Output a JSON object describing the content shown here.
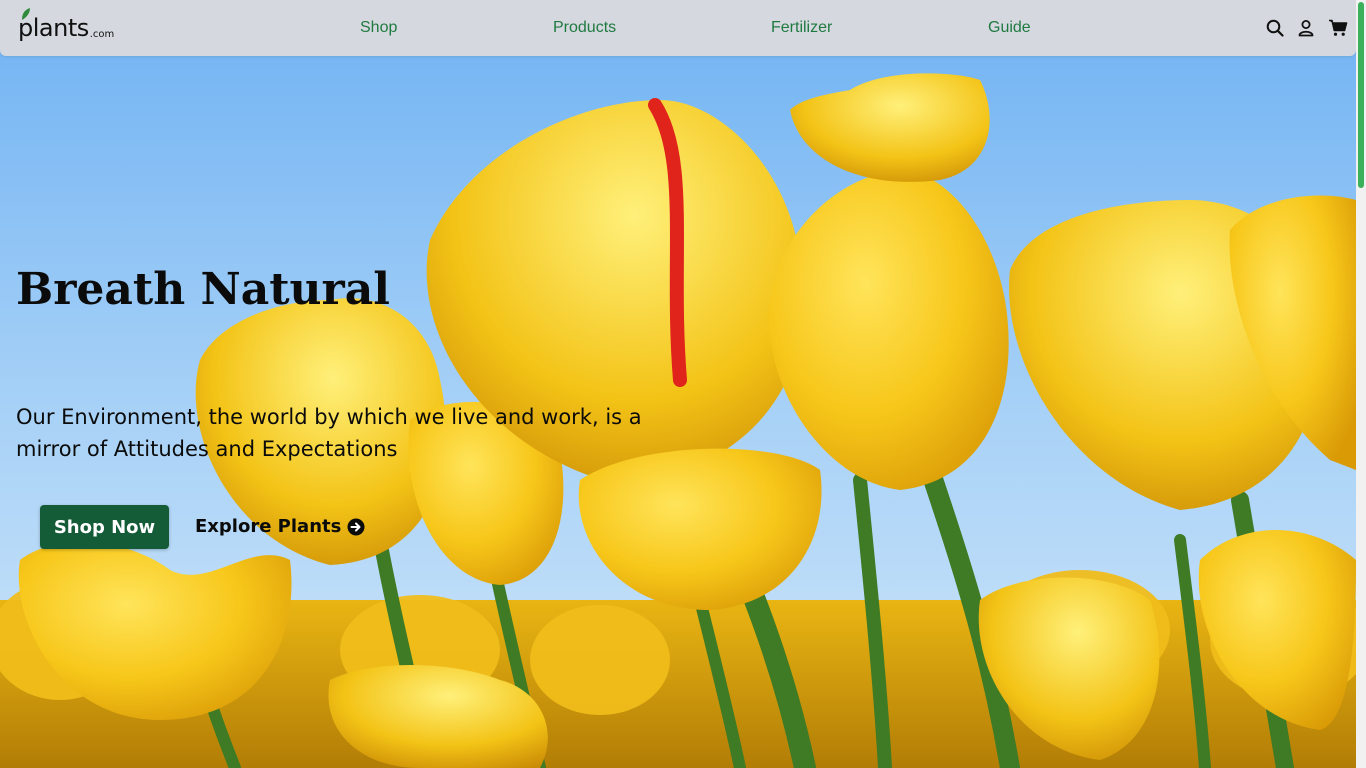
{
  "brand": {
    "name": "plants",
    "suffix": ".com"
  },
  "nav": {
    "links": [
      {
        "label": "Shop"
      },
      {
        "label": "Products"
      },
      {
        "label": "Fertilizer"
      },
      {
        "label": "Guide"
      }
    ],
    "icons": [
      "search-icon",
      "user-icon",
      "cart-icon"
    ],
    "link_color": "#1f7a40"
  },
  "hero": {
    "title": "Breath Natural",
    "subtitle": "Our Environment, the world by which we live and work, is a mirror of Attitudes and Expectations",
    "primary_button": "Shop Now",
    "secondary_link": "Explore Plants",
    "secondary_icon": "arrow-circle-right-icon",
    "background": "yellow-tulips-photo",
    "button_color": "#145c38"
  },
  "colors": {
    "navbar_bg": "#d5d8df",
    "accent_green": "#1f7a40",
    "scroll_thumb": "#3cb05a"
  }
}
